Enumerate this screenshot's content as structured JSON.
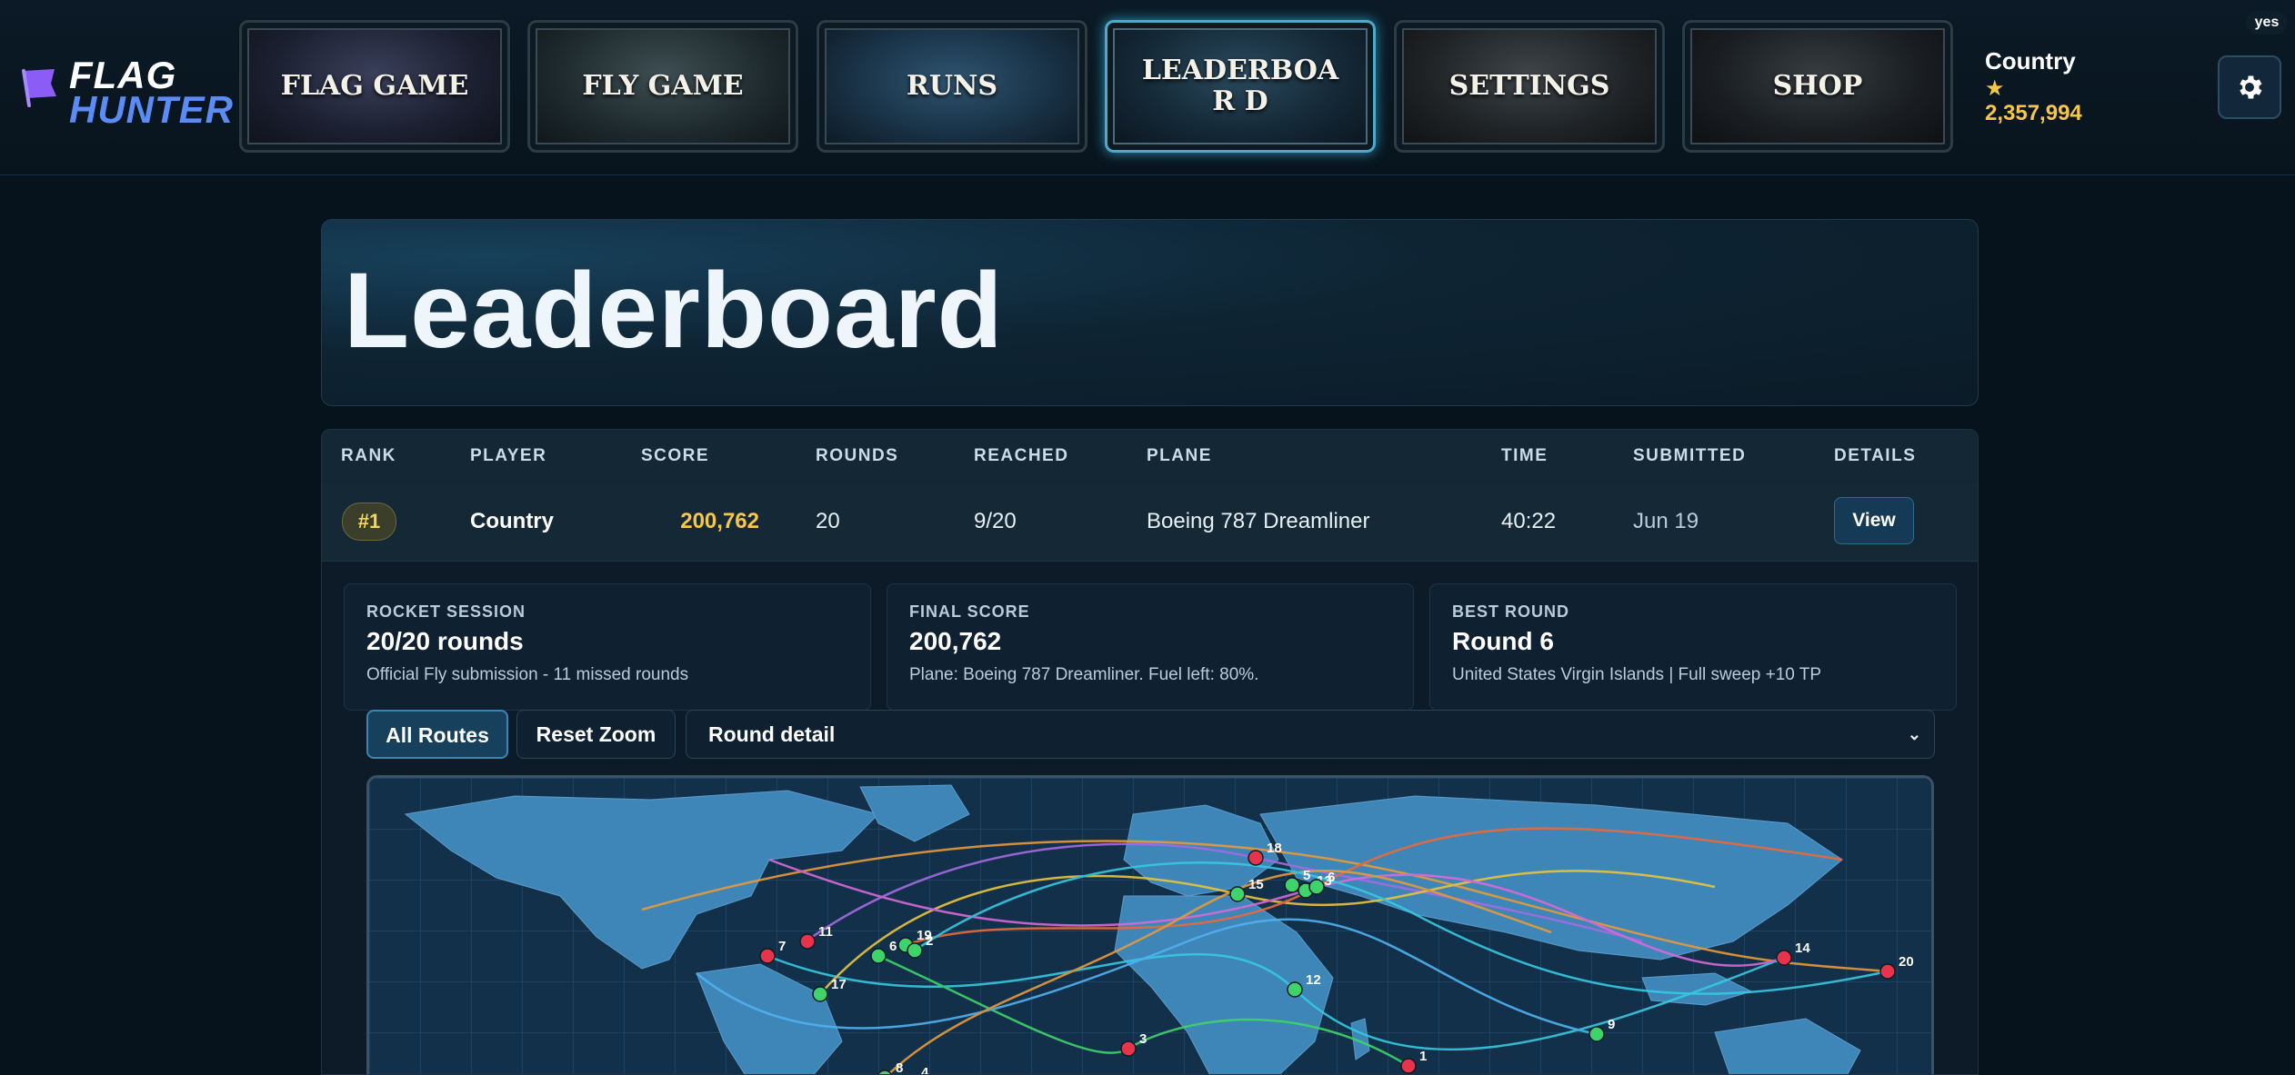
{
  "app": {
    "logo_line1": "FLAG",
    "logo_line2": "HUNTER",
    "badge": "yes"
  },
  "nav": {
    "flag_game": "FLAG GAME",
    "fly_game": "FLY GAME",
    "runs": "RUNS",
    "leaderboard": "LEADERBOAR D",
    "settings": "SETTINGS",
    "shop": "SHOP",
    "active": "leaderboard"
  },
  "user": {
    "name": "Country",
    "star": "★",
    "points": "2,357,994"
  },
  "page": {
    "title": "Leaderboard"
  },
  "table": {
    "headers": {
      "rank": "RANK",
      "player": "PLAYER",
      "score": "SCORE",
      "rounds": "ROUNDS",
      "reached": "REACHED",
      "plane": "PLANE",
      "time": "TIME",
      "submitted": "SUBMITTED",
      "details": "DETAILS"
    },
    "rows": [
      {
        "rank": "#1",
        "player": "Country",
        "score": "200,762",
        "rounds": "20",
        "reached": "9/20",
        "plane": "Boeing 787 Dreamliner",
        "time": "40:22",
        "submitted": "Jun 19",
        "details": "View"
      }
    ]
  },
  "details": {
    "cards": [
      {
        "key": "ROCKET SESSION",
        "value": "20/20 rounds",
        "desc": "Official Fly submission - 11 missed rounds"
      },
      {
        "key": "FINAL SCORE",
        "value": "200,762",
        "desc": "Plane: Boeing 787 Dreamliner. Fuel left: 80%."
      },
      {
        "key": "BEST ROUND",
        "value": "Round 6",
        "desc": "United States Virgin Islands | Full sweep +10 TP"
      }
    ],
    "buttons": {
      "all_routes": "All Routes",
      "reset_zoom": "Reset Zoom"
    },
    "round_select": {
      "value": "Round detail"
    }
  },
  "map": {
    "markers": [
      {
        "label": "18",
        "status": "missed"
      },
      {
        "label": "15",
        "status": "hit"
      },
      {
        "label": "5",
        "status": "hit"
      },
      {
        "label": "13",
        "status": "hit"
      },
      {
        "label": "6",
        "status": "hit"
      },
      {
        "label": "7",
        "status": "missed"
      },
      {
        "label": "11",
        "status": "missed"
      },
      {
        "label": "6",
        "status": "hit"
      },
      {
        "label": "19",
        "status": "hit"
      },
      {
        "label": "2",
        "status": "hit"
      },
      {
        "label": "17",
        "status": "hit"
      },
      {
        "label": "12",
        "status": "hit"
      },
      {
        "label": "14",
        "status": "missed"
      },
      {
        "label": "20",
        "status": "missed"
      },
      {
        "label": "9",
        "status": "hit"
      },
      {
        "label": "3",
        "status": "missed"
      },
      {
        "label": "1",
        "status": "missed"
      },
      {
        "label": "8",
        "status": "hit"
      },
      {
        "label": "4",
        "status": "missed"
      }
    ],
    "colors": {
      "hit": "#3fd46a",
      "missed": "#e8344a",
      "ocean": "#13304a",
      "land": "#3f86b8"
    }
  }
}
